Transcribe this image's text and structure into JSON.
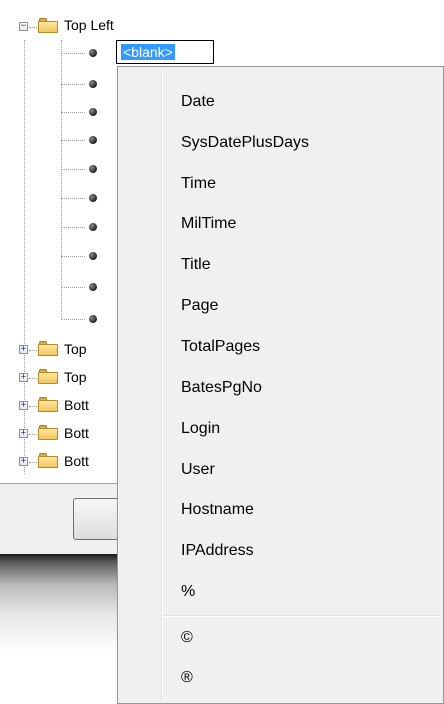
{
  "tree": {
    "root_label": "Top Left",
    "edit_text": "<blank>",
    "sibling_labels": [
      "Top",
      "Top",
      "Bott",
      "Bott",
      "Bott"
    ]
  },
  "menu": {
    "items": [
      "Date",
      "SysDatePlusDays",
      "Time",
      "MilTime",
      "Title",
      "Page",
      "TotalPages",
      "BatesPgNo",
      "Login",
      "User",
      "Hostname",
      "IPAddress",
      "%"
    ],
    "symbols": [
      "©",
      "®"
    ]
  }
}
